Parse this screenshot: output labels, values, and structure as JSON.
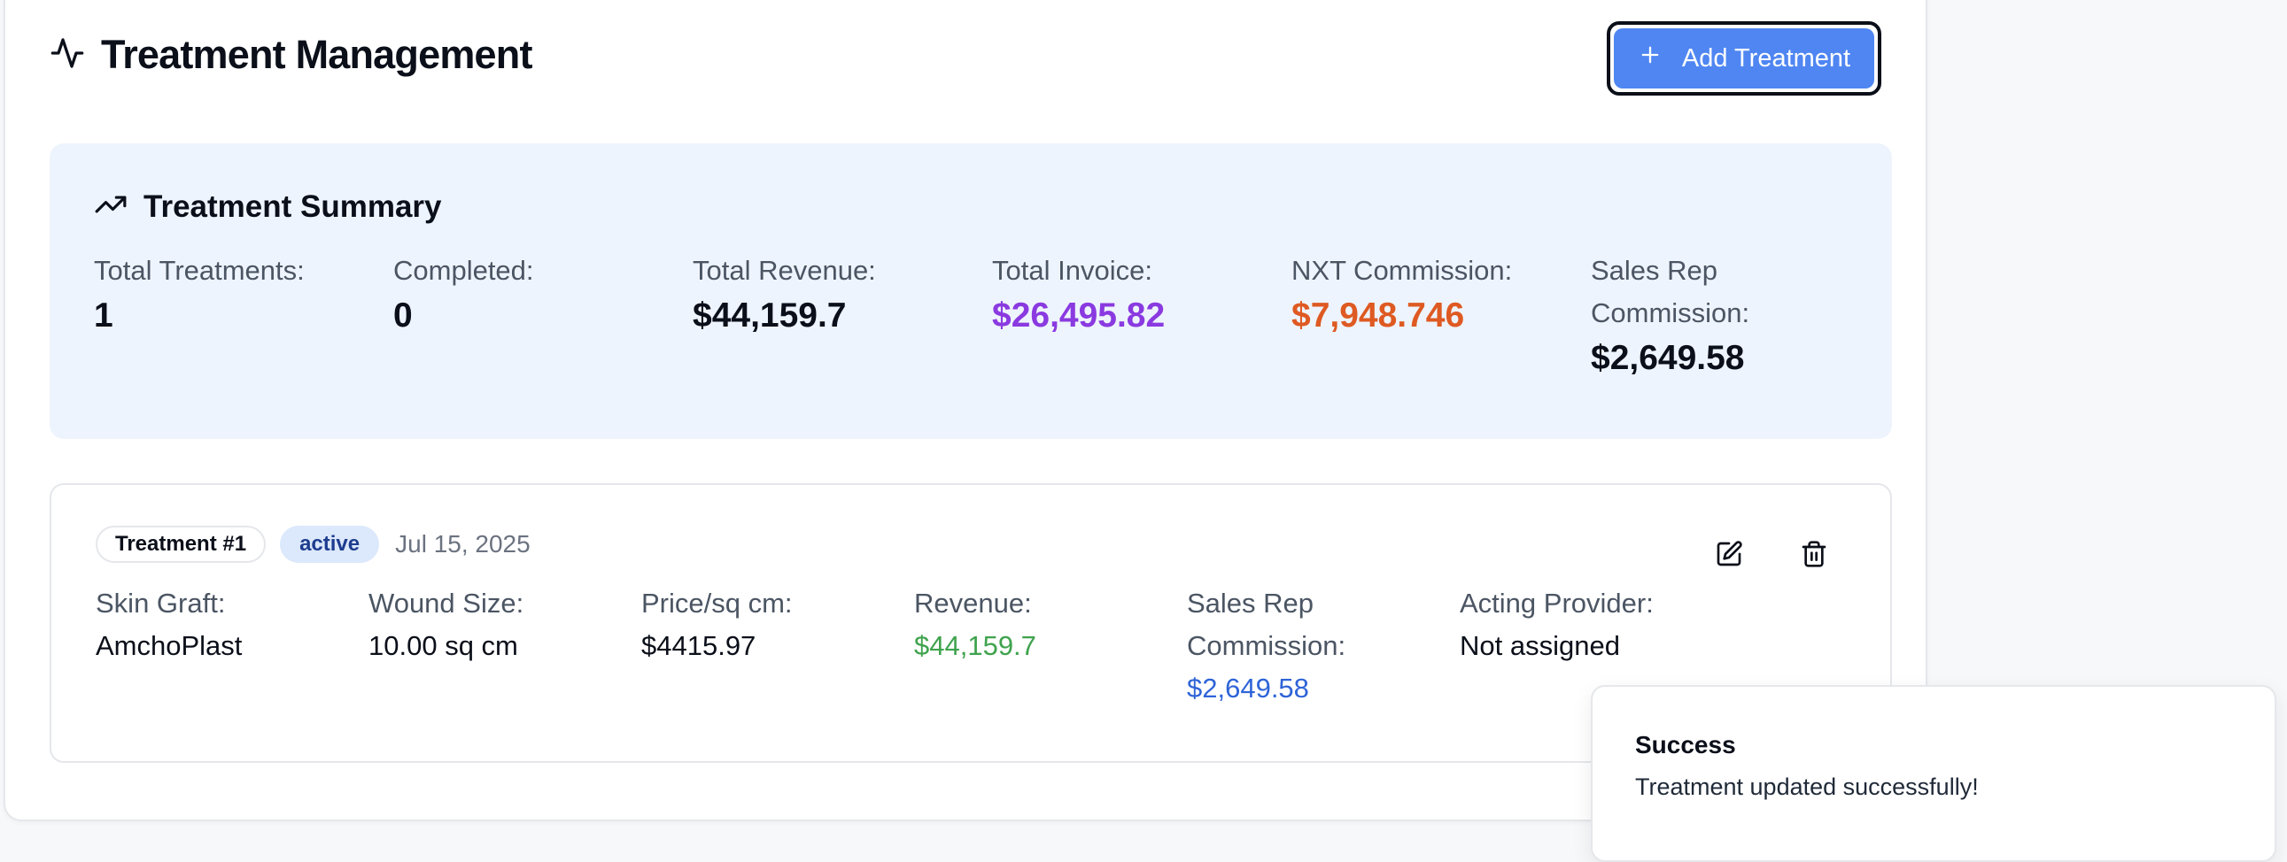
{
  "header": {
    "title": "Treatment Management",
    "title_icon": "activity-icon",
    "add_button_label": "Add Treatment",
    "add_button_icon": "plus-icon",
    "accent_color": "#4f86f2"
  },
  "summary": {
    "title": "Treatment Summary",
    "icon": "trending-up-icon",
    "stats": [
      {
        "label": "Total Treatments:",
        "value": "1"
      },
      {
        "label": "Completed:",
        "value": "0"
      },
      {
        "label": "Total Revenue:",
        "value": "$44,159.7"
      },
      {
        "label": "Total Invoice:",
        "value": "$26,495.82",
        "color": "#8a3ae0"
      },
      {
        "label": "NXT Commission:",
        "value": "$7,948.746",
        "color": "#de5a22"
      },
      {
        "label": "Sales Rep Commission:",
        "value": "$2,649.58"
      }
    ]
  },
  "treatment": {
    "number_label": "Treatment #1",
    "status": "active",
    "date": "Jul 15, 2025",
    "edit_icon": "edit-icon",
    "delete_icon": "trash-icon",
    "fields": [
      {
        "label": "Skin Graft:",
        "value": "AmchoPlast"
      },
      {
        "label": "Wound Size:",
        "value": "10.00 sq cm"
      },
      {
        "label": "Price/sq cm:",
        "value": "$4415.97"
      },
      {
        "label": "Revenue:",
        "value": "$44,159.7",
        "color": "#3fa34d"
      },
      {
        "label": "Sales Rep Commission:",
        "value": "$2,649.58",
        "color": "#2f64d8"
      },
      {
        "label": "Acting Provider:",
        "value": "Not assigned"
      }
    ]
  },
  "toast": {
    "title": "Success",
    "message": "Treatment updated successfully!"
  }
}
